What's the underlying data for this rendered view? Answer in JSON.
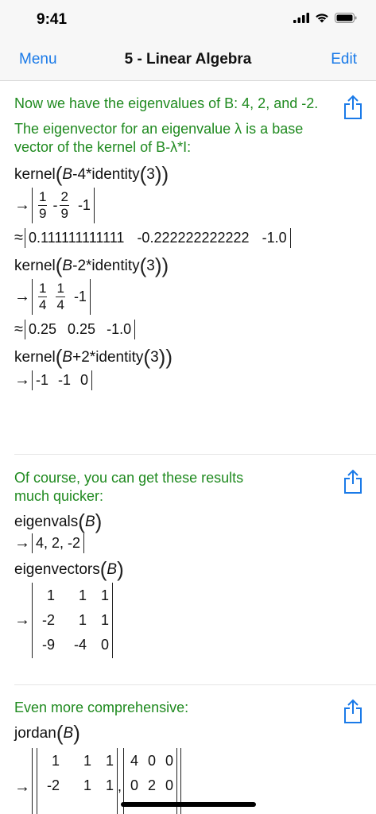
{
  "status": {
    "time": "9:41"
  },
  "nav": {
    "menu": "Menu",
    "title": "5 - Linear Algebra",
    "edit": "Edit"
  },
  "icons": {
    "signal": "cellular-signal-icon",
    "wifi": "wifi-icon",
    "battery": "battery-icon",
    "share": "share-icon"
  },
  "colors": {
    "accent": "#1a7ae8",
    "comment": "#1f8a1f"
  },
  "s1": {
    "comment1": "Now we have the eigenvalues of B: 4, 2, and -2.",
    "comment2": "The eigenvector for an eigenvalue λ is a base vector of the kernel of B-λ*I:",
    "e1": {
      "fn": "kernel",
      "var": "B",
      "op": "-",
      "val": "4",
      "rest": "*identity",
      "arg": "3"
    },
    "r1": {
      "n1": "1",
      "d1": "9",
      "sign2": "-",
      "n2": "2",
      "d2": "9",
      "v3": "-1"
    },
    "a1": {
      "v1": "0.111111111111",
      "v2": "-0.222222222222",
      "v3": "-1.0"
    },
    "e2": {
      "fn": "kernel",
      "var": "B",
      "op": "-",
      "val": "2",
      "rest": "*identity",
      "arg": "3"
    },
    "r2": {
      "n1": "1",
      "d1": "4",
      "n2": "1",
      "d2": "4",
      "v3": "-1"
    },
    "a2": {
      "v1": "0.25",
      "v2": "0.25",
      "v3": "-1.0"
    },
    "e3": {
      "fn": "kernel",
      "var": "B",
      "op": "+",
      "val": "2",
      "rest": "*identity",
      "arg": "3"
    },
    "r3": {
      "v1": "-1",
      "v2": "-1",
      "v3": "0"
    }
  },
  "s2": {
    "comment": "Of course, you can get these results much quicker:",
    "e1": {
      "fn": "eigenvals",
      "var": "B"
    },
    "r1": "4, 2, -2",
    "e2": {
      "fn": "eigenvectors",
      "var": "B"
    },
    "matrix": [
      [
        "1",
        "1",
        "1"
      ],
      [
        "-2",
        "1",
        "1"
      ],
      [
        "-9",
        "-4",
        "0"
      ]
    ]
  },
  "s3": {
    "comment": "Even more comprehensive:",
    "e1": {
      "fn": "jordan",
      "var": "B"
    },
    "m1": [
      [
        "1",
        "1",
        "1"
      ],
      [
        "-2",
        "1",
        "1"
      ]
    ],
    "m2": [
      [
        "4",
        "0",
        "0"
      ],
      [
        "0",
        "2",
        "0"
      ]
    ]
  },
  "symbols": {
    "arrow": "→",
    "approx": "≈"
  }
}
